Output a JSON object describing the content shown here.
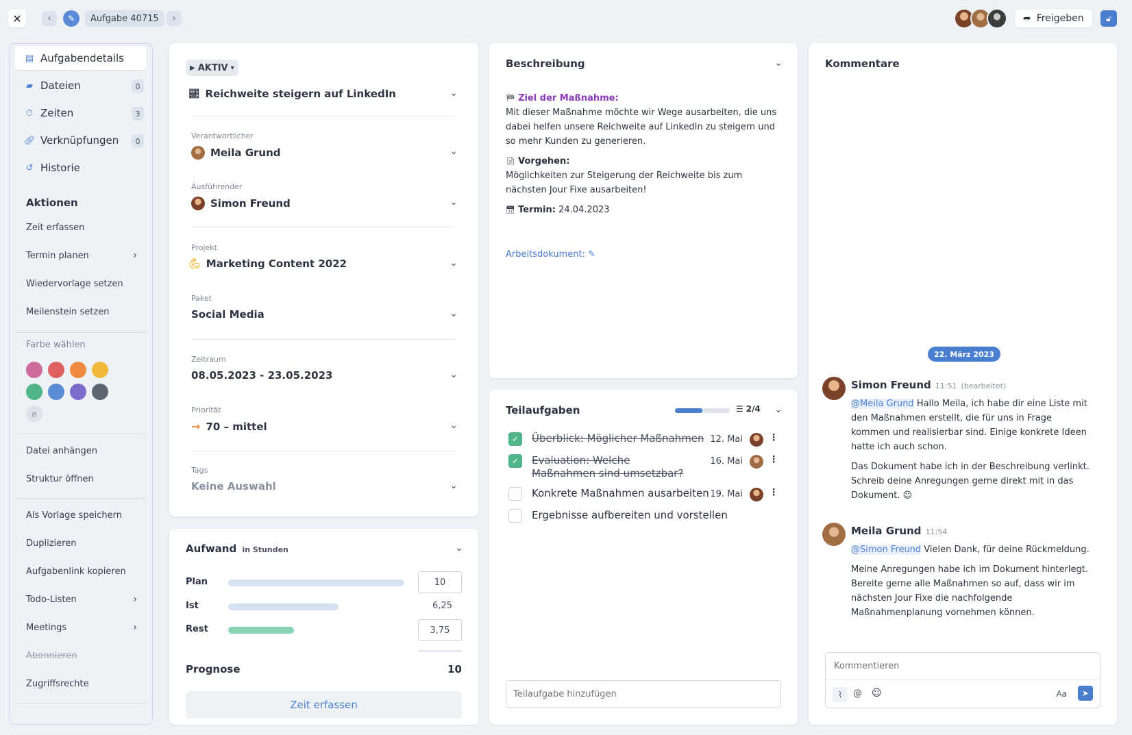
{
  "topbar": {
    "task_label": "Aufgabe 40715",
    "share_label": "Freigeben"
  },
  "sidebar": {
    "items": [
      {
        "label": "Aufgabendetails",
        "icon": "clipboard-icon",
        "count": ""
      },
      {
        "label": "Dateien",
        "icon": "folder-icon",
        "count": "0"
      },
      {
        "label": "Zeiten",
        "icon": "stopwatch-icon",
        "count": "3"
      },
      {
        "label": "Verknüpfungen",
        "icon": "link-icon",
        "count": "0"
      },
      {
        "label": "Historie",
        "icon": "history-icon",
        "count": ""
      }
    ],
    "actions_heading": "Aktionen",
    "actions": [
      "Zeit erfassen",
      "Termin planen",
      "Wiedervorlage setzen",
      "Meilenstein setzen"
    ],
    "color_heading": "Farbe wählen",
    "colors": [
      "#cd6b9c",
      "#e0605f",
      "#ef8a3f",
      "#f0b93a",
      "#4fb58a",
      "#5b8bd6",
      "#7b6ccc",
      "#5d6670"
    ],
    "actions2": [
      "Datei anhängen",
      "Struktur öffnen"
    ],
    "actions3": [
      "Als Vorlage speichern",
      "Duplizieren",
      "Aufgabenlink kopieren",
      "Todo-Listen",
      "Meetings",
      "Abonnieren",
      "Zugriffsrechte"
    ]
  },
  "details": {
    "status": "AKTIV",
    "title": "Reichweite steigern auf LinkedIn",
    "responsible_label": "Verantwortlicher",
    "responsible": "Meila Grund",
    "executor_label": "Ausführender",
    "executor": "Simon Freund",
    "project_label": "Projekt",
    "project": "Marketing Content 2022",
    "package_label": "Paket",
    "package": "Social Media",
    "period_label": "Zeitraum",
    "period": "08.05.2023 - 23.05.2023",
    "priority_label": "Priorität",
    "priority": "70 – mittel",
    "tags_label": "Tags",
    "tags": "Keine Auswahl"
  },
  "effort": {
    "title": "Aufwand",
    "unit": "in Stunden",
    "plan_label": "Plan",
    "plan": "10",
    "actual_label": "Ist",
    "actual": "6,25",
    "rest_label": "Rest",
    "rest": "3,75",
    "forecast_label": "Prognose",
    "forecast": "10",
    "button": "Zeit erfassen",
    "plan_fill": 1.0,
    "actual_fill": 0.625,
    "rest_fill": 0.375
  },
  "description": {
    "title": "Beschreibung",
    "goal_label": "Ziel der Maßnahme:",
    "goal_text": "Mit dieser Maßnahme möchte wir Wege ausarbeiten, die uns dabei helfen unsere Reichweite auf LinkedIn zu steigern und so mehr Kunden zu generieren.",
    "approach_label": "Vorgehen:",
    "approach_text": "Möglichkeiten zur Steigerung der Reichweite bis zum nächsten Jour Fixe ausarbeiten!",
    "deadline_label": "Termin:",
    "deadline": "24.04.2023",
    "doc_link": "Arbeitsdokument:"
  },
  "subtasks": {
    "title": "Teilaufgaben",
    "progress_text": "2/4",
    "progress": 0.5,
    "items": [
      {
        "text": "Überblick: Möglicher Maßnahmen",
        "date": "12. Mai",
        "done": true
      },
      {
        "text": "Evaluation: Welche Maßnahmen sind umsetzbar?",
        "date": "16. Mai",
        "done": true
      },
      {
        "text": "Konkrete Maßnahmen ausarbeiten",
        "date": "19. Mai",
        "done": false
      },
      {
        "text": "Ergebnisse aufbereiten und vorstellen",
        "date": "",
        "done": false
      }
    ],
    "add_placeholder": "Teilaufgabe hinzufügen"
  },
  "comments": {
    "title": "Kommentare",
    "date_pill": "22. März 2023",
    "list": [
      {
        "author": "Simon Freund",
        "time": "11:51",
        "edited": "(bearbeitet)",
        "mention": "@Meila Grund",
        "text1": " Hallo Meila, ich habe dir eine Liste mit den Maßnahmen erstellt, die für uns in Frage kommen und realisierbar sind. Einige konkrete Ideen hatte ich auch schon.",
        "text2": "Das Dokument habe ich in der Beschreibung verlinkt. Schreib deine Anregungen gerne direkt mit in das Dokument."
      },
      {
        "author": "Meila Grund",
        "time": "11:54",
        "edited": "",
        "mention": "@Simon Freund",
        "text1": " Vielen Dank, für deine Rückmeldung.",
        "text2": "Meine Anregungen habe ich im Dokument hinterlegt. Bereite gerne alle Maßnahmen so auf, dass wir im nächsten Jour Fixe die nachfolgende Maßnahmenplanung vornehmen können."
      }
    ],
    "input_placeholder": "Kommentieren",
    "format_label": "Aa"
  }
}
